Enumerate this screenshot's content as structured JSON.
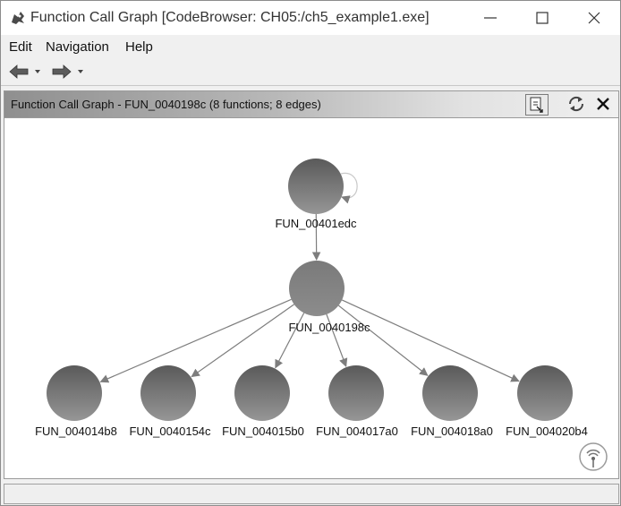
{
  "window": {
    "title": "Function Call Graph [CodeBrowser: CH05:/ch5_example1.exe]",
    "app_icon": "ghidra-dragon-icon"
  },
  "menubar": {
    "items": [
      "Edit",
      "Navigation",
      "Help"
    ]
  },
  "toolbar": {
    "back_icon": "back-arrow-icon",
    "forward_icon": "forward-arrow-icon"
  },
  "panel": {
    "title": "Function Call Graph - FUN_0040198c (8 functions; 8 edges)",
    "snapshot_icon": "snapshot-icon",
    "refresh_icon": "refresh-icon",
    "close_icon": "close-icon"
  },
  "graph": {
    "nodes": [
      {
        "id": "n0",
        "label": "FUN_00401edc"
      },
      {
        "id": "n1",
        "label": "FUN_0040198c"
      },
      {
        "id": "n2",
        "label": "FUN_004014b8"
      },
      {
        "id": "n3",
        "label": "FUN_0040154c"
      },
      {
        "id": "n4",
        "label": "FUN_004015b0"
      },
      {
        "id": "n5",
        "label": "FUN_004017a0"
      },
      {
        "id": "n6",
        "label": "FUN_004018a0"
      },
      {
        "id": "n7",
        "label": "FUN_004020b4"
      }
    ],
    "edges": [
      [
        "n0",
        "n0"
      ],
      [
        "n0",
        "n1"
      ],
      [
        "n1",
        "n2"
      ],
      [
        "n1",
        "n3"
      ],
      [
        "n1",
        "n4"
      ],
      [
        "n1",
        "n5"
      ],
      [
        "n1",
        "n6"
      ],
      [
        "n1",
        "n7"
      ]
    ],
    "satellite_icon": "satellite-view-icon",
    "colors": {
      "node_top": "#5a5a5a",
      "node_bottom": "#969696",
      "edge": "#7d7d7d"
    }
  }
}
